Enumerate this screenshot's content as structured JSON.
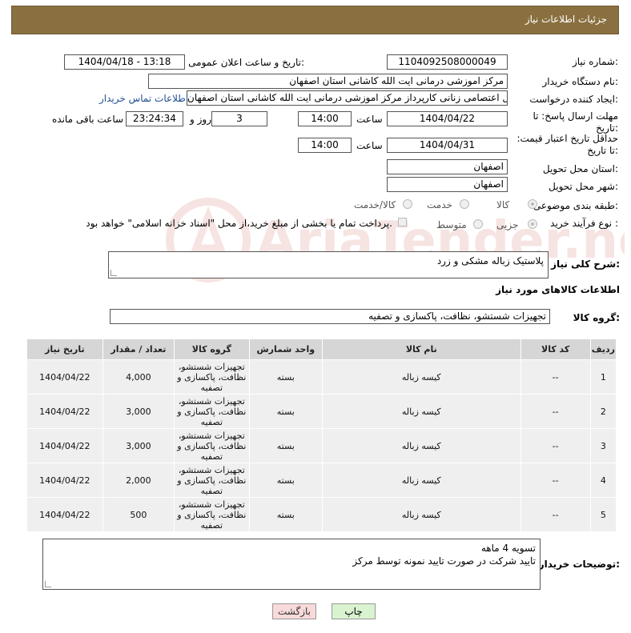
{
  "header": {
    "title": "جزئیات اطلاعات نیاز"
  },
  "fields": {
    "need_number_label": "شماره نیاز:",
    "need_number": "1104092508000049",
    "announce_label": "تاریخ و ساعت اعلان عمومی:",
    "announce_value": "1404/04/18 - 13:18",
    "buyer_label": "نام دستگاه خریدار:",
    "buyer_value": "مرکز اموزشی درمانی ایت الله کاشانی استان اصفهان",
    "creator_label": "ایجاد کننده درخواست:",
    "creator_value": "سیدرسول اعتصامی زنانی کارپرداز مرکز اموزشی درمانی ایت الله کاشانی استان اصفهان",
    "contact_link": "اطلاعات تماس خریدار",
    "deadline_label": "مهلت ارسال پاسخ: تا تاریخ:",
    "deadline_date": "1404/04/22",
    "time_label": "ساعت",
    "deadline_time": "14:00",
    "days_value": "3",
    "days_label": "روز و",
    "remaining_value": "23:24:34",
    "remaining_label": "ساعت باقی مانده",
    "price_label": "حداقل تاریخ اعتبار قیمت: تا تاریخ:",
    "price_date": "1404/04/31",
    "price_time": "14:00",
    "province_label": "استان محل تحویل:",
    "province_value": "اصفهان",
    "city_label": "شهر محل تحویل:",
    "city_value": "اصفهان",
    "category_label": "طبقه بندی موضوعی:",
    "category_options": [
      "کالا",
      "خدمت",
      "کالا/خدمت"
    ],
    "process_label": "نوع فرآیند خرید :",
    "process_options": [
      "جزیی",
      "متوسط"
    ],
    "payment_note": "پرداخت تمام یا بخشی از مبلغ خرید،از محل \"اسناد خزانه اسلامی\" خواهد بود."
  },
  "description": {
    "label": "شرح کلی نیاز:",
    "value": "پلاستیک زباله مشکی و زرد"
  },
  "goods_section": {
    "title": "اطلاعات کالاهای مورد نیاز",
    "group_label": "گروه کالا:",
    "group_value": "تجهیزات شستشو، نظافت، پاکسازی و تصفیه"
  },
  "table": {
    "headers": [
      "ردیف",
      "کد کالا",
      "نام کالا",
      "واحد شمارش",
      "گروه کالا",
      "تعداد / مقدار",
      "تاریخ نیاز"
    ],
    "rows": [
      [
        "1",
        "--",
        "کیسه زباله",
        "بسته",
        "تجهیزات شستشو، نظافت، پاکسازی و تصفیه",
        "4,000",
        "1404/04/22"
      ],
      [
        "2",
        "--",
        "کیسه زباله",
        "بسته",
        "تجهیزات شستشو، نظافت، پاکسازی و تصفیه",
        "3,000",
        "1404/04/22"
      ],
      [
        "3",
        "--",
        "کیسه زباله",
        "بسته",
        "تجهیزات شستشو، نظافت، پاکسازی و تصفیه",
        "3,000",
        "1404/04/22"
      ],
      [
        "4",
        "--",
        "کیسه زباله",
        "بسته",
        "تجهیزات شستشو، نظافت، پاکسازی و تصفیه",
        "2,000",
        "1404/04/22"
      ],
      [
        "5",
        "--",
        "کیسه زباله",
        "بسته",
        "تجهیزات شستشو، نظافت، پاکسازی و تصفیه",
        "500",
        "1404/04/22"
      ]
    ]
  },
  "buyer_notes": {
    "label": "توضیحات خریدار:",
    "line1": "تسویه 4 ماهه",
    "line2": "تایید شرکت در صورت تایید نمونه توسط مرکز"
  },
  "buttons": {
    "print": "چاپ",
    "back": "بازگشت"
  },
  "watermark": {
    "text": "AriaTender.neT"
  },
  "colors": {
    "header_bg": "#8a7040",
    "print_btn": "#d9f2d0",
    "back_btn": "#f8dada"
  }
}
